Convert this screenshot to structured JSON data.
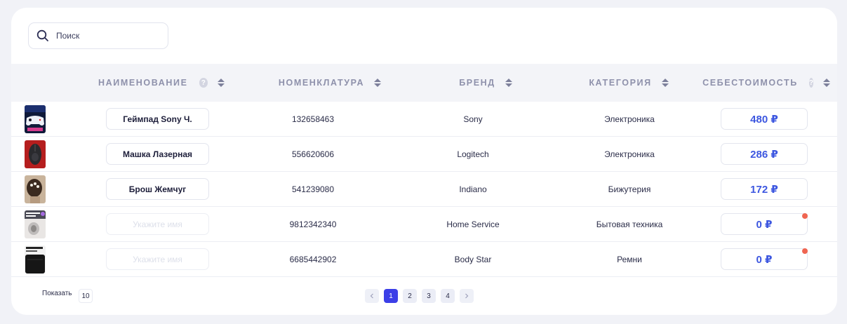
{
  "search": {
    "placeholder": "Поиск"
  },
  "columns": [
    {
      "label": "Наименование",
      "help": "?"
    },
    {
      "label": "Номенклатура"
    },
    {
      "label": "Бренд"
    },
    {
      "label": "Категория"
    },
    {
      "label": "Себестоимость",
      "help": "?"
    }
  ],
  "name_placeholder": "Укажите имя",
  "rows": [
    {
      "thumb": "gamepad-image",
      "name": "Геймпад Sony Ч.",
      "sku": "132658463",
      "brand": "Sony",
      "category": "Электроника",
      "cost": "480 ₽",
      "alert": false
    },
    {
      "thumb": "mouse-image",
      "name": "Машка Лазерная",
      "sku": "556620606",
      "brand": "Logitech",
      "category": "Электроника",
      "cost": "286 ₽",
      "alert": false
    },
    {
      "thumb": "brooch-image",
      "name": "Брош Жемчуг",
      "sku": "541239080",
      "brand": "Indiano",
      "category": "Бижутерия",
      "cost": "172 ₽",
      "alert": false
    },
    {
      "thumb": "appliance-image",
      "name": "",
      "sku": "9812342340",
      "brand": "Home Service",
      "category": "Бытовая техника",
      "cost": "0 ₽",
      "alert": true
    },
    {
      "thumb": "belt-image",
      "name": "",
      "sku": "6685442902",
      "brand": "Body Star",
      "category": "Ремни",
      "cost": "0 ₽",
      "alert": true
    }
  ],
  "footer": {
    "show_label": "Показать",
    "page_size": "10",
    "pages": [
      "1",
      "2",
      "3",
      "4"
    ],
    "current_page": "1",
    "prev_icon": "chevron-left-icon",
    "next_icon": "chevron-right-icon"
  },
  "colors": {
    "accent": "#3c3fe7",
    "cost": "#3d57e0",
    "alert": "#ef6551"
  }
}
